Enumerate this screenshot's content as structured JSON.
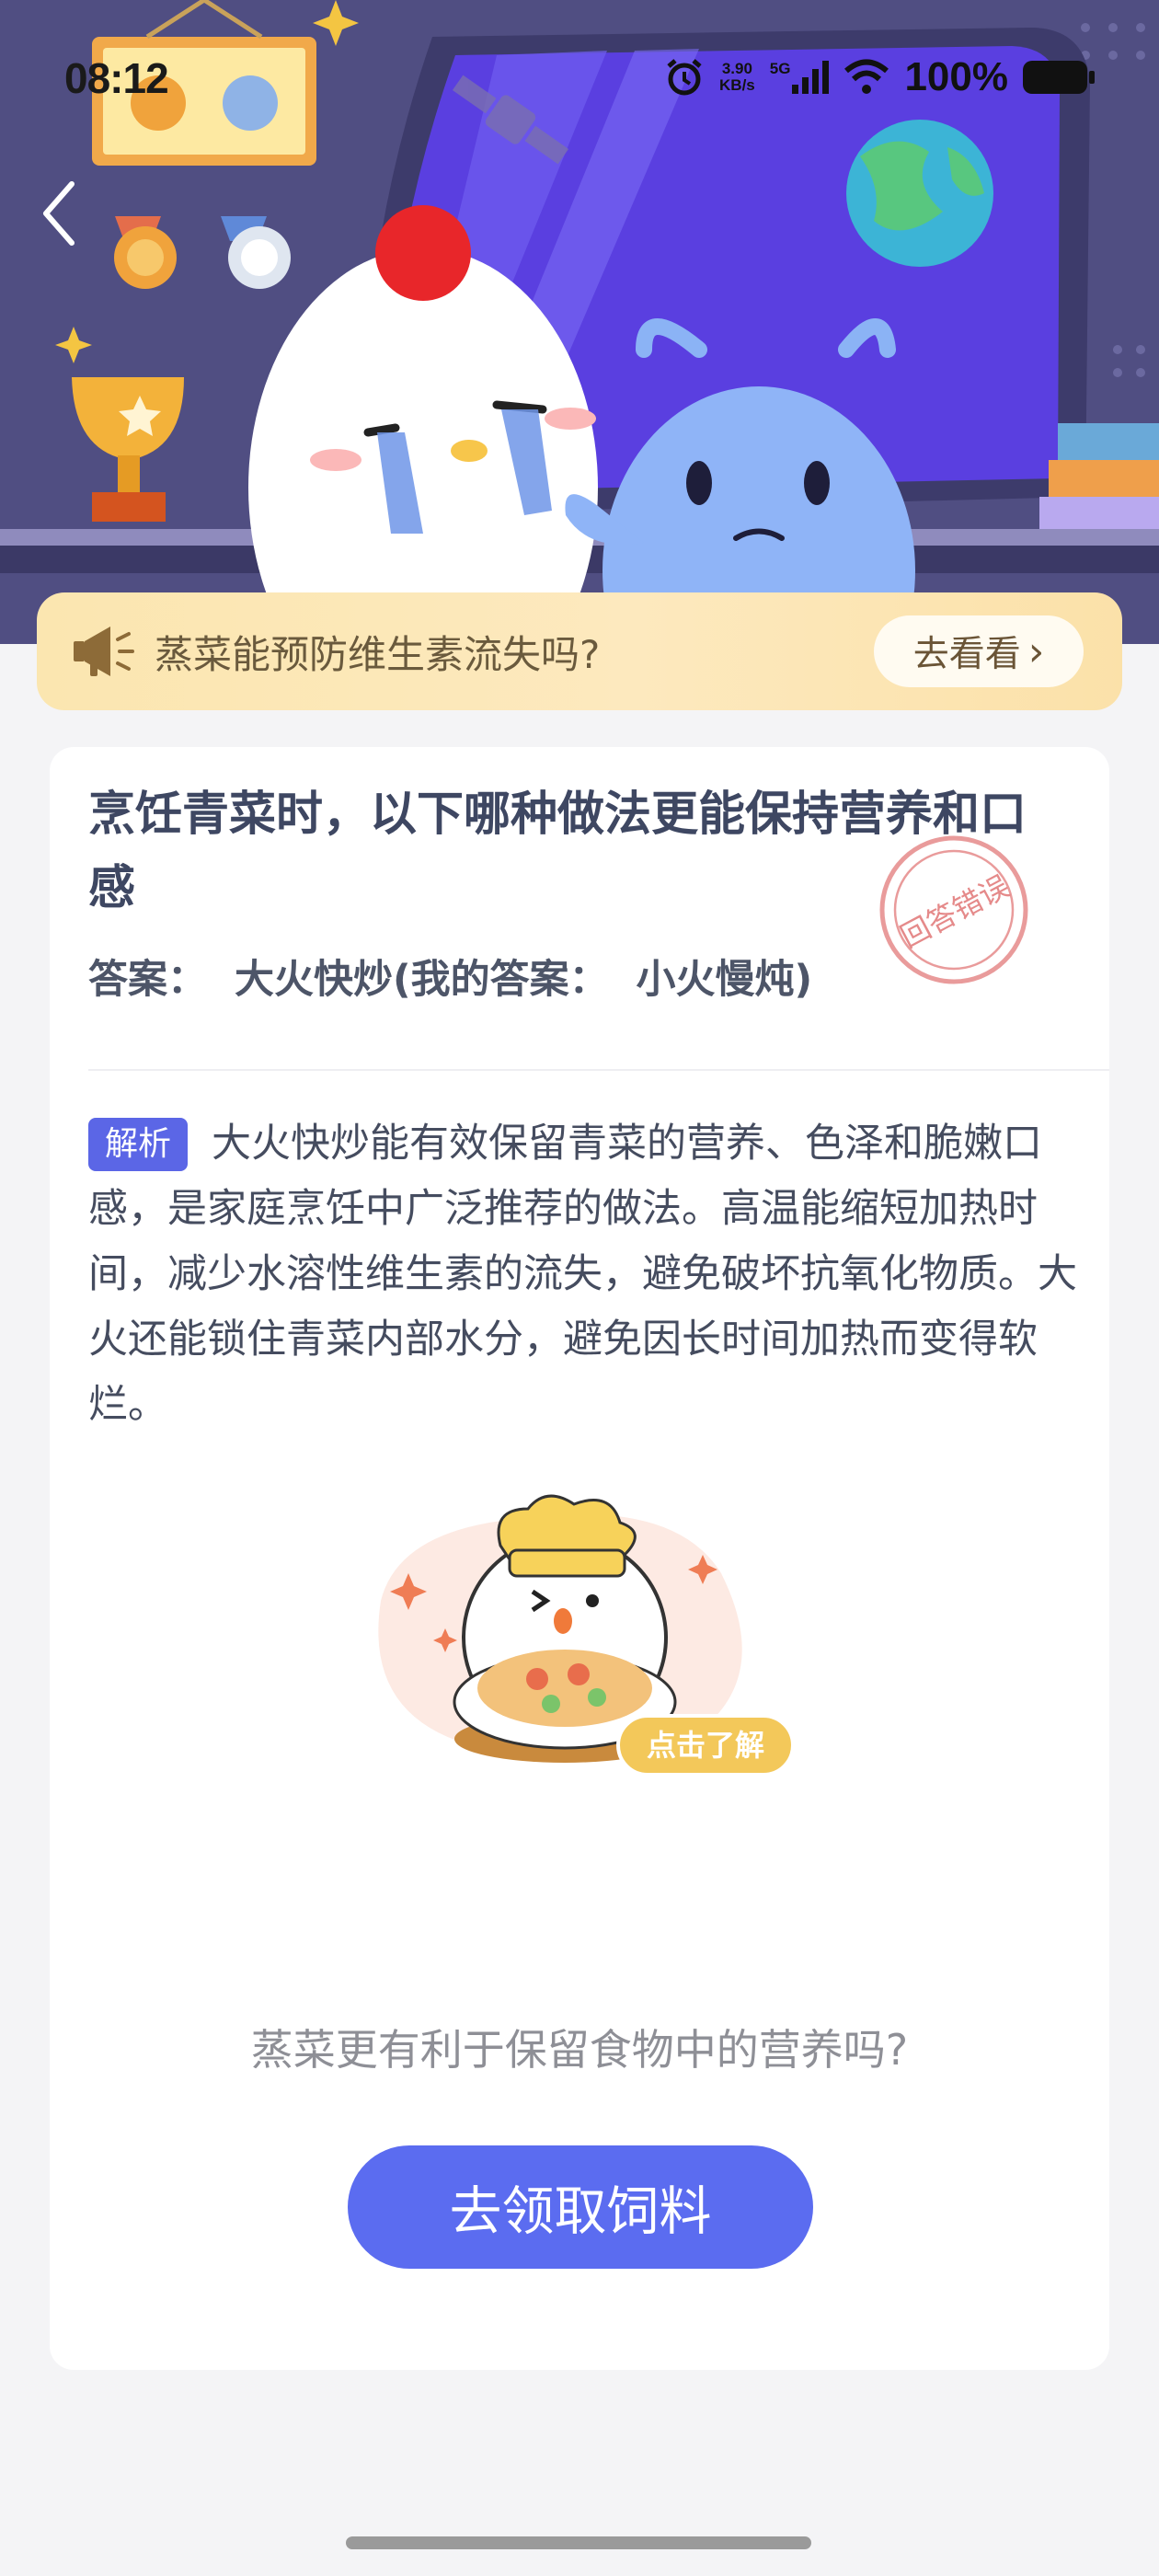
{
  "status_bar": {
    "time": "08:12",
    "net_speed": "3.90",
    "net_unit": "KB/s",
    "network": "5G",
    "battery": "100%"
  },
  "notice": {
    "text": "蒸菜能预防维生素流失吗?",
    "button": "去看看",
    "chevron": "›"
  },
  "question": {
    "title": "烹饪青菜时，以下哪种做法更能保持营养和口感",
    "answer_line": "答案：  大火快炒(我的答案：  小火慢炖)",
    "stamp_text": "回答错误"
  },
  "analysis": {
    "tag": "解析",
    "text": "大火快炒能有效保留青菜的营养、色泽和脆嫩口感，是家庭烹饪中广泛推荐的做法。高温能缩短加热时间，减少水溶性维生素的流失，避免破坏抗氧化物质。大火还能锁住青菜内部水分，避免因长时间加热而变得软烂。"
  },
  "promo": {
    "badge": "点击了解",
    "question": "蒸菜更有利于保留食物中的营养吗?"
  },
  "cta": {
    "label": "去领取饲料"
  },
  "colors": {
    "accent": "#5b6cf0",
    "tag": "#5b66e6",
    "stamp": "#e58a8a",
    "notice_bg": "#fbe6b0"
  },
  "icons": [
    "back-arrow-icon",
    "alarm-icon",
    "signal-icon",
    "wifi-icon",
    "battery-icon",
    "megaphone-icon",
    "chevron-right-icon",
    "wrong-answer-stamp"
  ]
}
